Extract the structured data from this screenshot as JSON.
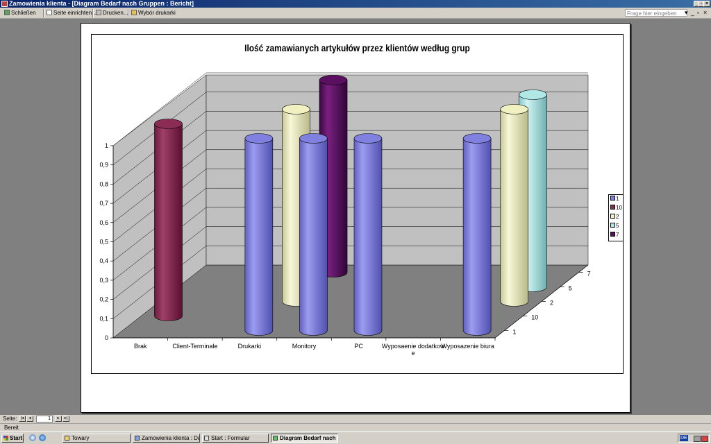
{
  "window": {
    "title": "Zamowienia klienta - [Diagram Bedarf nach Gruppen : Bericht]",
    "controls": [
      "_",
      "▫",
      "×"
    ]
  },
  "toolbar": {
    "close_label": "Schließen",
    "page_setup_label": "Seite einrichten...",
    "print_label": "Drucken...",
    "printer_select_label": "Wybór drukarki",
    "help_placeholder": "Frage hier eingeben",
    "doc_controls": [
      "▾",
      "_",
      "▫",
      "×"
    ]
  },
  "chart_data": {
    "type": "bar",
    "title": "Ilość zamawianych artykułów przez klientów według grup",
    "categories": [
      "Brak",
      "Client-Terminale",
      "Drukarki",
      "Monitory",
      "PC",
      "Wyposaenie dodatkow e",
      "Wyposazenie biura"
    ],
    "ylim": [
      0,
      1
    ],
    "yticks": [
      "0",
      "0,1",
      "0,2",
      "0,3",
      "0,4",
      "0,5",
      "0,6",
      "0,7",
      "0,8",
      "0,9",
      "1"
    ],
    "depth_axis": [
      "1",
      "10",
      "2",
      "5",
      "7"
    ],
    "legend_placement": "right",
    "series": [
      {
        "name": "1",
        "color": "#8080e0",
        "values": [
          null,
          null,
          1,
          1,
          1,
          null,
          1
        ]
      },
      {
        "name": "10",
        "color": "#8b2c55",
        "values": [
          1,
          null,
          null,
          null,
          null,
          null,
          null
        ]
      },
      {
        "name": "2",
        "color": "#f0f0c0",
        "values": [
          null,
          null,
          1,
          null,
          null,
          null,
          1
        ]
      },
      {
        "name": "5",
        "color": "#b0e8e8",
        "values": [
          null,
          null,
          null,
          null,
          null,
          null,
          1
        ]
      },
      {
        "name": "7",
        "color": "#5a0f60",
        "values": [
          null,
          null,
          1,
          null,
          null,
          null,
          null
        ]
      }
    ]
  },
  "navigation": {
    "page_label": "Seite:",
    "page_number": "1",
    "buttons": [
      "|◂",
      "◂",
      "▸",
      "▸|"
    ]
  },
  "status": {
    "text": "Bereit"
  },
  "taskbar": {
    "start_label": "Start",
    "tasks": [
      "Towary",
      "Zamowienia klienta : Dat...",
      "Start : Formular",
      "Diagram Bedarf nach ..."
    ],
    "language": "DE"
  }
}
